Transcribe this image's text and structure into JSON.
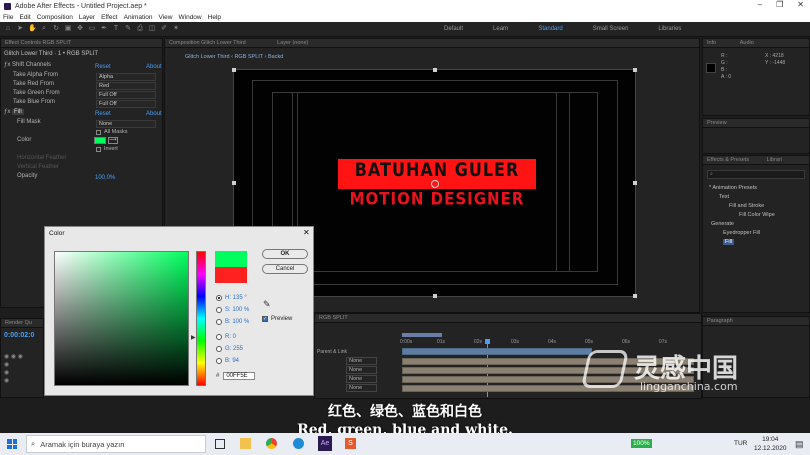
{
  "app": {
    "title": "Adobe After Effects - Untitled Project.aep *"
  },
  "menu": [
    "File",
    "Edit",
    "Composition",
    "Layer",
    "Effect",
    "Animation",
    "View",
    "Window",
    "Help"
  ],
  "workspaces": {
    "items": [
      "Default",
      "Learn",
      "Standard",
      "Small Screen",
      "Libraries"
    ],
    "active": "Standard"
  },
  "effect_controls": {
    "tab": "Effect Controls  RGB SPLIT",
    "breadcrumb": "Glitch Lower Third · 1 • RGB SPLIT",
    "shift_channels": {
      "name": "Shift Channels",
      "reset": "Reset",
      "about": "About",
      "rows": [
        {
          "label": "Take Alpha From",
          "value": "Alpha"
        },
        {
          "label": "Take Red From",
          "value": "Red"
        },
        {
          "label": "Take Green From",
          "value": "Full Off"
        },
        {
          "label": "Take Blue From",
          "value": "Full Off"
        }
      ]
    },
    "fill": {
      "name": "Fill",
      "reset": "Reset",
      "about": "About",
      "fill_mask_label": "Fill Mask",
      "fill_mask_value": "None",
      "all_masks": "All Masks",
      "color_label": "Color",
      "invert": "Invert",
      "horiz_feather": "Horizontal Feather",
      "vert_feather": "Vertical Feather",
      "opacity_label": "Opacity",
      "opacity_value": "100,0%",
      "swatch_color": "#00FF5E"
    }
  },
  "composition": {
    "tab": "Composition  Glitch Lower Third",
    "layer_tab": "Layer  (none)",
    "breadcrumb_1": "Glitch Lower Third",
    "breadcrumb_2": "RGB SPLIT",
    "breadcrumb_3": "Backd",
    "headline": "BATUHAN GULER",
    "subline": "MOTION DESIGNER",
    "headline_color": "#ff1313",
    "subline_color": "#e8131c"
  },
  "info_panel": {
    "tabs": [
      "Info",
      "Audio"
    ],
    "r": "R :",
    "g": "G :",
    "b": "B :",
    "a": "A : 0",
    "x": "X : 4218",
    "y": "Y : -1448"
  },
  "preview_panel": {
    "title": "Preview"
  },
  "effects_presets": {
    "title": "Effects & Presets",
    "tab2": "Librari",
    "search": "",
    "items": [
      "* Animation Presets",
      "Text",
      "Fill and Stroke",
      "Fill Color Wipe",
      "Generate",
      "Eyedropper Fill",
      "Fill"
    ]
  },
  "project_panel": {
    "title": "Render Qu",
    "timecode": "0:00:02:0"
  },
  "timeline": {
    "tab": "RGB SPLIT",
    "column_header": "Parent & Link",
    "parent_values": [
      "None",
      "None",
      "None",
      "None"
    ],
    "ruler": [
      "0:00s",
      "01s",
      "02s",
      "03s",
      "04s",
      "05s",
      "06s",
      "07s"
    ]
  },
  "paragraph_panel": {
    "title": "Paragraph"
  },
  "color_dialog": {
    "title": "Color",
    "ok": "OK",
    "cancel": "Cancel",
    "h": "H: 135 °",
    "s": "S: 100 %",
    "b": "B: 100 %",
    "r": "R: 0",
    "g": "G: 255",
    "bl": "B: 94",
    "hex": "00FF5E",
    "preview": "Preview",
    "new_color": "#00FF5E",
    "old_color": "#ff2020"
  },
  "subtitles": {
    "chinese": "红色、绿色、蓝色和白色",
    "english": "Red, green, blue and white."
  },
  "watermark": {
    "brand_cn": "灵感中国",
    "brand_url": "lingganchina.com"
  },
  "taskbar": {
    "search_placeholder": "Aramak için buraya yazın",
    "battery": "100%",
    "language": "TUR",
    "time": "19:04",
    "date": "12.12.2020"
  }
}
